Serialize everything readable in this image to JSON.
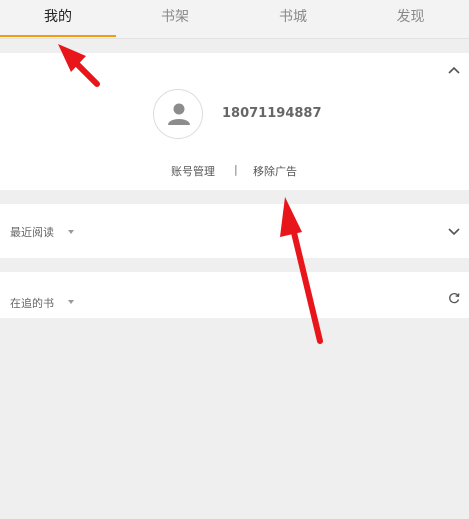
{
  "tabs": [
    "我的",
    "书架",
    "书城",
    "发现"
  ],
  "profile": {
    "phone": "18071194887",
    "account_manage": "账号管理",
    "separator": "|",
    "remove_ads": "移除广告"
  },
  "sections": {
    "recent_reading": "最近阅读",
    "following_books": "在追的书"
  },
  "colors": {
    "accent": "#f39c12",
    "annotation_arrow": "#e8161b"
  },
  "icons": [
    "chevron-up-icon",
    "user-icon",
    "caret-down-icon",
    "chevron-down-icon",
    "refresh-icon"
  ]
}
